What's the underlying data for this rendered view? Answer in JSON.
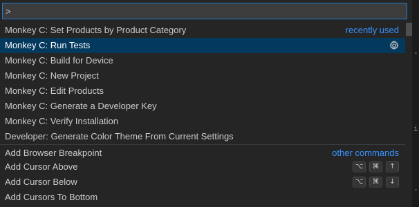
{
  "palette": {
    "input_value": ">",
    "input_placeholder": "",
    "groups": [
      {
        "hint": "recently used",
        "items": [
          {
            "label": "Monkey C: Set Products by Product Category",
            "selected": false
          },
          {
            "label": "Monkey C: Run Tests",
            "selected": true,
            "icon": "gear-icon"
          },
          {
            "label": "Monkey C: Build for Device",
            "selected": false
          },
          {
            "label": "Monkey C: New Project",
            "selected": false
          },
          {
            "label": "Monkey C: Edit Products",
            "selected": false
          },
          {
            "label": "Monkey C: Generate a Developer Key",
            "selected": false
          },
          {
            "label": "Monkey C: Verify Installation",
            "selected": false
          },
          {
            "label": "Developer: Generate Color Theme From Current Settings",
            "selected": false
          }
        ]
      },
      {
        "hint": "other commands",
        "items": [
          {
            "label": "Add Browser Breakpoint",
            "keys": []
          },
          {
            "label": "Add Cursor Above",
            "keys": [
              "⌥",
              "⌘",
              "↑"
            ]
          },
          {
            "label": "Add Cursor Below",
            "keys": [
              "⌥",
              "⌘",
              "↓"
            ]
          },
          {
            "label": "Add Cursors To Bottom",
            "keys": []
          }
        ]
      }
    ]
  },
  "colors": {
    "selection_bg": "#04395e",
    "hint_text": "#3794ff",
    "input_border": "#1e7bd1"
  }
}
